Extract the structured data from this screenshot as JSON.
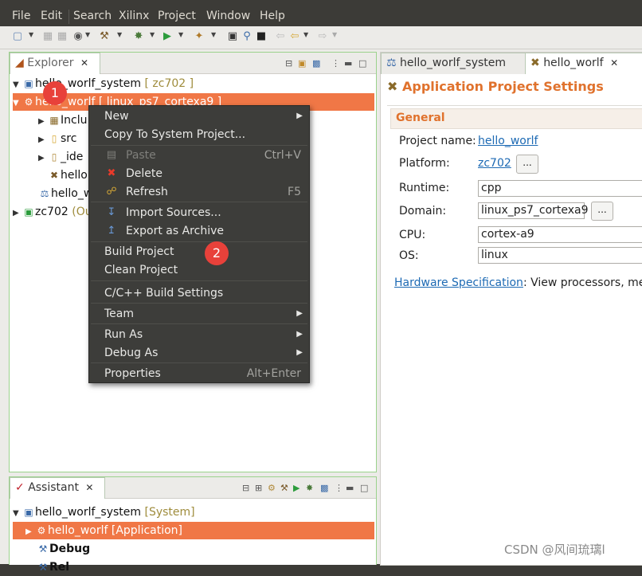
{
  "menubar": [
    "File",
    "Edit",
    "Search",
    "Xilinx",
    "Project",
    "Window",
    "Help"
  ],
  "explorer": {
    "tab_label": "Explorer",
    "tree": [
      {
        "label": "hello_worlf_system",
        "suffix": "[ zc702 ]"
      },
      {
        "label": "hello_worlf [ linux_ps7_cortexa9 ]",
        "suffix": ""
      },
      {
        "label": "Inclu",
        "suffix": ""
      },
      {
        "label": "src",
        "suffix": ""
      },
      {
        "label": "_ide",
        "suffix": ""
      },
      {
        "label": "hello",
        "suffix": ""
      },
      {
        "label": "hello_w",
        "suffix": ""
      },
      {
        "label": "zc702",
        "suffix": "(Ou"
      }
    ]
  },
  "context_menu": {
    "items": [
      {
        "label": "New",
        "shortcut": ""
      },
      {
        "label": "Copy To System Project...",
        "shortcut": ""
      },
      {
        "label": "Paste",
        "shortcut": "Ctrl+V"
      },
      {
        "label": "Delete",
        "shortcut": ""
      },
      {
        "label": "Refresh",
        "shortcut": "F5"
      },
      {
        "label": "Import Sources...",
        "shortcut": ""
      },
      {
        "label": "Export as Archive",
        "shortcut": ""
      },
      {
        "label": "Build Project",
        "shortcut": ""
      },
      {
        "label": "Clean Project",
        "shortcut": ""
      },
      {
        "label": "C/C++ Build Settings",
        "shortcut": ""
      },
      {
        "label": "Team",
        "shortcut": ""
      },
      {
        "label": "Run As",
        "shortcut": ""
      },
      {
        "label": "Debug As",
        "shortcut": ""
      },
      {
        "label": "Properties",
        "shortcut": "Alt+Enter"
      }
    ]
  },
  "badges": {
    "one": "1",
    "two": "2"
  },
  "editor": {
    "tabs": [
      "hello_worlf_system",
      "hello_worlf"
    ],
    "title": "Application Project Settings",
    "section": "General",
    "project_name_label": "Project name:",
    "project_name_value": "hello_worlf",
    "platform_label": "Platform:",
    "platform_value": "zc702",
    "runtime_label": "Runtime:",
    "runtime_value": "cpp",
    "domain_label": "Domain:",
    "domain_value": "linux_ps7_cortexa9",
    "cpu_label": "CPU:",
    "cpu_value": "cortex-a9",
    "os_label": "OS:",
    "os_value": "linux",
    "hw_link": "Hardware Specification",
    "hw_text": ": View processors, mem",
    "dots": "..."
  },
  "assistant": {
    "tab_label": "Assistant",
    "tree": [
      {
        "label": "hello_worlf_system",
        "suffix": "[System]"
      },
      {
        "label": "hello_worlf [Application]",
        "suffix": ""
      },
      {
        "label": "Debug",
        "suffix": ""
      },
      {
        "label": "Rel",
        "suffix": ""
      }
    ]
  },
  "watermark": "CSDN @风间琉璃l",
  "colors": {
    "selection": "#f07746",
    "accent_title": "#e0722d",
    "panel_border": "#9bd28c",
    "badge": "#e8413a",
    "link": "#1d6ab4"
  }
}
